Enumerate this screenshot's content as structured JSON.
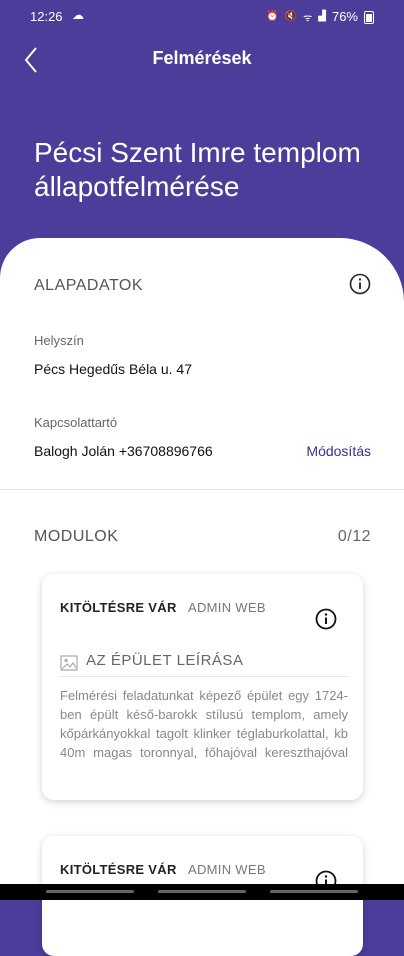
{
  "statusbar": {
    "time": "12:26",
    "battery": "76%"
  },
  "header": {
    "title": "Felmérések"
  },
  "page": {
    "title": "Pécsi Szent Imre templom állapotfelmérése"
  },
  "alapadatok": {
    "title": "ALAPADATOK",
    "location_label": "Helyszín",
    "location_value": "Pécs Hegedűs Béla u. 47",
    "contact_label": "Kapcsolattartó",
    "contact_value": "Balogh Jolán +36708896766",
    "modify_label": "Módosítás"
  },
  "modules": {
    "title": "MODULOK",
    "count": "0/12",
    "cards": [
      {
        "status": "KITÖLTÉSRE VÁR",
        "tag": "ADMIN WEB",
        "title": "AZ ÉPÜLET LEÍRÁSA",
        "description": "Felmérési feladatunkat képező épület egy 1724-ben épült késő-barokk stílusú templom, amely kőpárkányokkal tagolt klinker téglaburkolattal, kb 40m magas toronnyal, főhajóval kereszthajóval és"
      },
      {
        "status": "KITÖLTÉSRE VÁR",
        "tag": "ADMIN WEB"
      }
    ]
  },
  "colors": {
    "header": "#4d3d9a",
    "link": "#3b2f8e"
  }
}
